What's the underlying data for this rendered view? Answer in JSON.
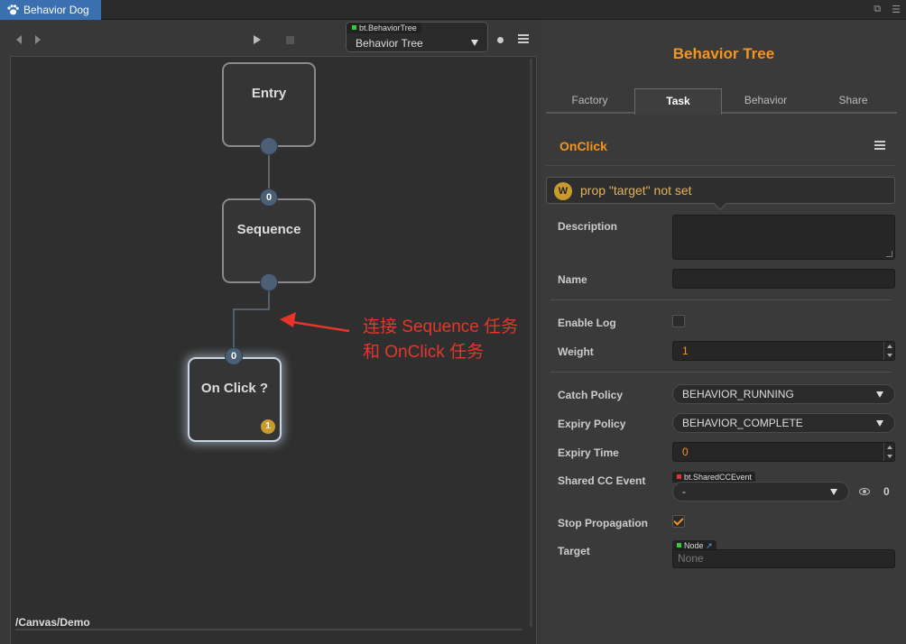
{
  "window": {
    "tab_title": "Behavior Dog"
  },
  "toolbar": {
    "tree_type_badge": "bt.BehaviorTree",
    "tree_select_value": "Behavior Tree"
  },
  "canvas": {
    "nodes": [
      {
        "label": "Entry"
      },
      {
        "label": "Sequence",
        "port_index": "0"
      },
      {
        "label": "On Click ?",
        "port_index": "0",
        "badge": "1"
      }
    ],
    "annotation_line1": "连接 Sequence 任务",
    "annotation_line2": "和 OnClick 任务",
    "annotation_color": "#e8352b",
    "path": "/Canvas/Demo"
  },
  "inspector": {
    "title": "Behavior Tree",
    "tabs": [
      "Factory",
      "Task",
      "Behavior",
      "Share"
    ],
    "active_tab": "Task",
    "task_name": "OnClick",
    "warning_icon": "W",
    "warning_text": "prop \"target\" not set",
    "accent_color": "#f29521",
    "props": {
      "description_label": "Description",
      "description_value": "",
      "name_label": "Name",
      "name_value": "",
      "enable_log_label": "Enable Log",
      "enable_log_checked": false,
      "weight_label": "Weight",
      "weight_value": "1",
      "catch_policy_label": "Catch Policy",
      "catch_policy_value": "BEHAVIOR_RUNNING",
      "expiry_policy_label": "Expiry Policy",
      "expiry_policy_value": "BEHAVIOR_COMPLETE",
      "expiry_time_label": "Expiry Time",
      "expiry_time_value": "0",
      "shared_event_label": "Shared CC Event",
      "shared_event_badge": "bt.SharedCCEvent",
      "shared_event_value": "-",
      "shared_event_count": "0",
      "stop_propagation_label": "Stop Propagation",
      "stop_propagation_checked": true,
      "target_label": "Target",
      "target_badge": "Node",
      "target_value": "None"
    }
  }
}
